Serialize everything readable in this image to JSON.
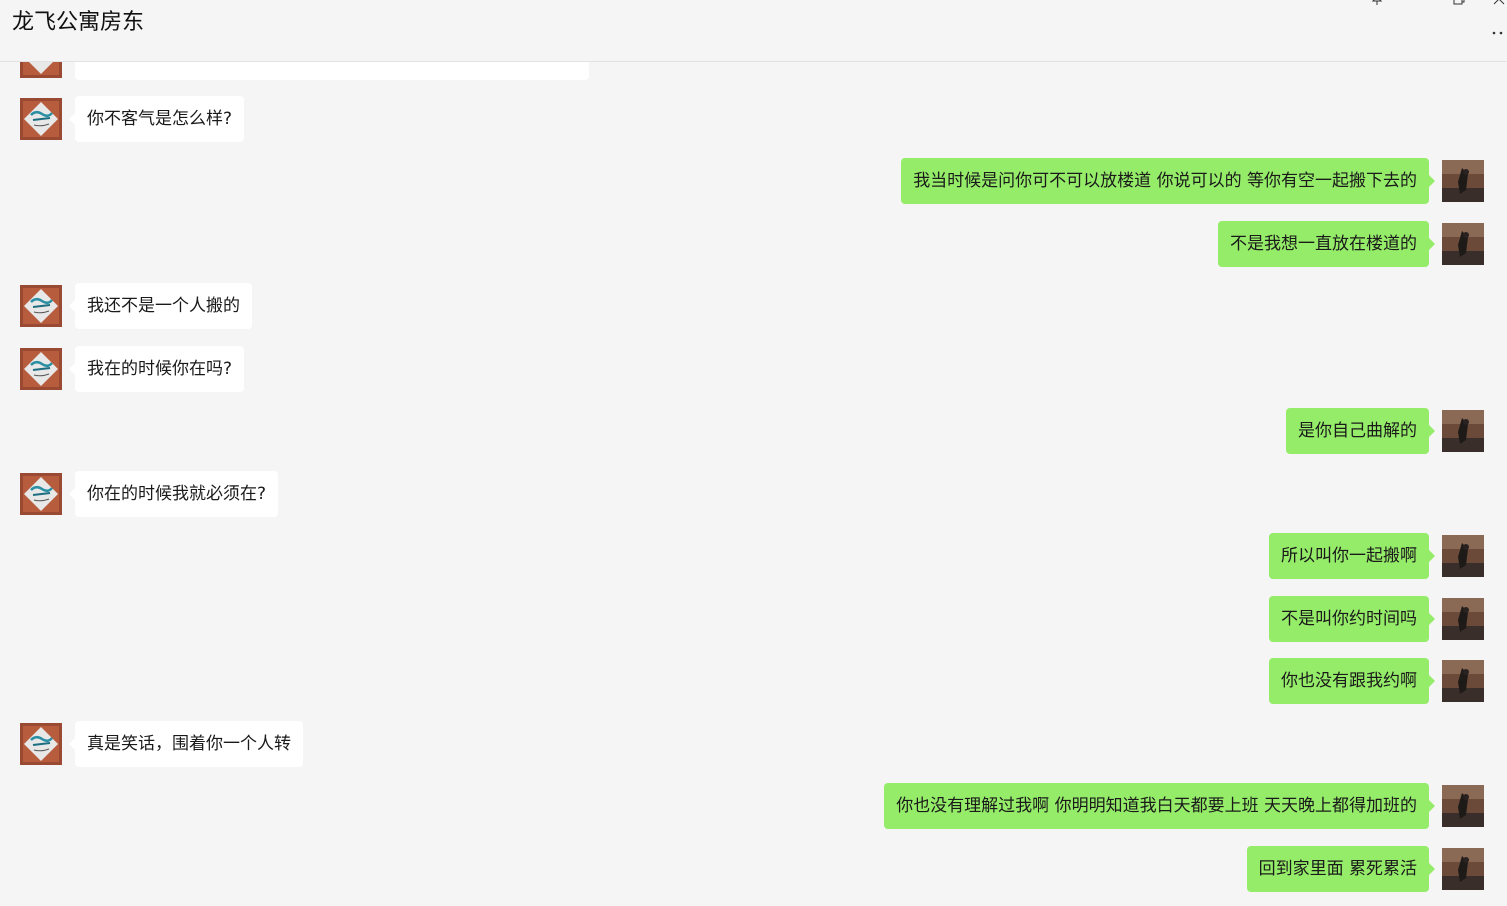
{
  "window": {
    "title": "龙飞公寓房东",
    "controls": {
      "pin_icon": "pin-icon",
      "minimize_icon": "minimize-icon",
      "maximize_icon": "maximize-icon",
      "close_icon": "close-icon",
      "more_icon": "more-icon"
    }
  },
  "colors": {
    "background": "#f5f5f5",
    "incoming_bubble": "#ffffff",
    "outgoing_bubble": "#95ec69",
    "text": "#1a1a1a"
  },
  "messages": [
    {
      "side": "left",
      "text": "你不客气是怎么样?"
    },
    {
      "side": "right",
      "text": "我当时候是问你可不可以放楼道 你说可以的 等你有空一起搬下去的"
    },
    {
      "side": "right",
      "text": "不是我想一直放在楼道的"
    },
    {
      "side": "left",
      "text": "我还不是一个人搬的"
    },
    {
      "side": "left",
      "text": "我在的时候你在吗?"
    },
    {
      "side": "right",
      "text": "是你自己曲解的"
    },
    {
      "side": "left",
      "text": "你在的时候我就必须在?"
    },
    {
      "side": "right",
      "text": "所以叫你一起搬啊"
    },
    {
      "side": "right",
      "text": "不是叫你约时间吗"
    },
    {
      "side": "right",
      "text": "你也没有跟我约啊"
    },
    {
      "side": "left",
      "text": "真是笑话，围着你一个人转"
    },
    {
      "side": "right",
      "text": "你也没有理解过我啊 你明明知道我白天都要上班 天天晚上都得加班的"
    },
    {
      "side": "right",
      "text": "回到家里面 累死累活"
    }
  ]
}
